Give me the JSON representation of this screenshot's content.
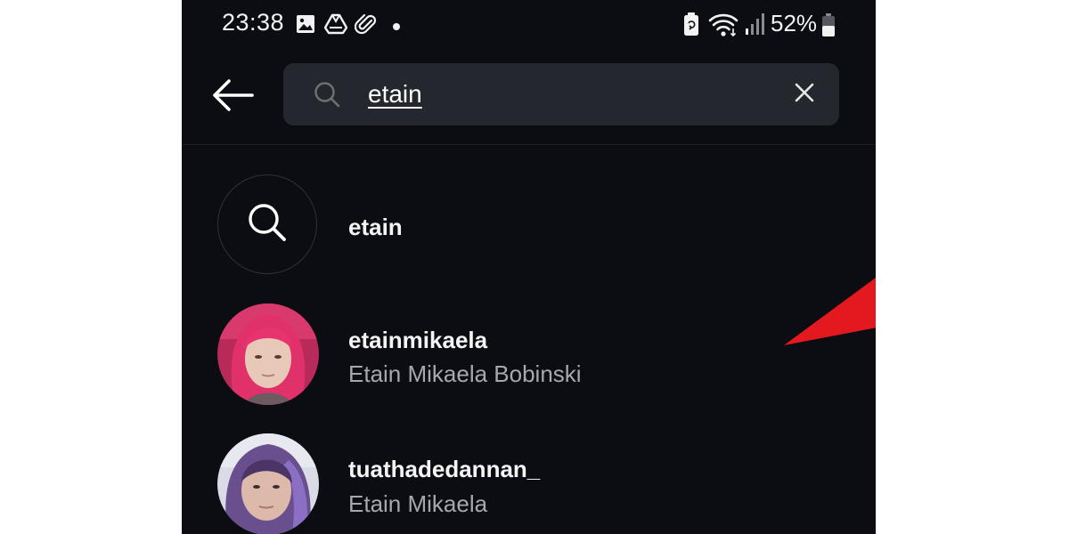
{
  "status_bar": {
    "time": "23:38",
    "battery_percent": "52%",
    "icons": [
      "image-icon",
      "drive-icon",
      "paperclip-icon",
      "dot-icon",
      "battery-saver-icon",
      "wifi-icon",
      "signal-icon",
      "battery-icon"
    ]
  },
  "search": {
    "query": "etain",
    "back_icon": "arrow-left-icon",
    "search_icon": "search-icon",
    "clear_icon": "close-icon"
  },
  "results": [
    {
      "type": "keyword",
      "label": "etain",
      "icon": "search-icon"
    },
    {
      "type": "account",
      "username": "etainmikaela",
      "full_name": "Etain Mikaela Bobinski",
      "avatar": "profile-photo-pink-hair"
    },
    {
      "type": "account",
      "username": "tuathadedannan_",
      "full_name": "Etain Mikaela",
      "avatar": "profile-photo-purple-hair"
    }
  ],
  "colors": {
    "background": "#0c0d12",
    "search_box": "#25272e",
    "primary_text": "#f4f4f4",
    "secondary_text": "#a7a8ad",
    "annotation_arrow": "#e3191f"
  }
}
